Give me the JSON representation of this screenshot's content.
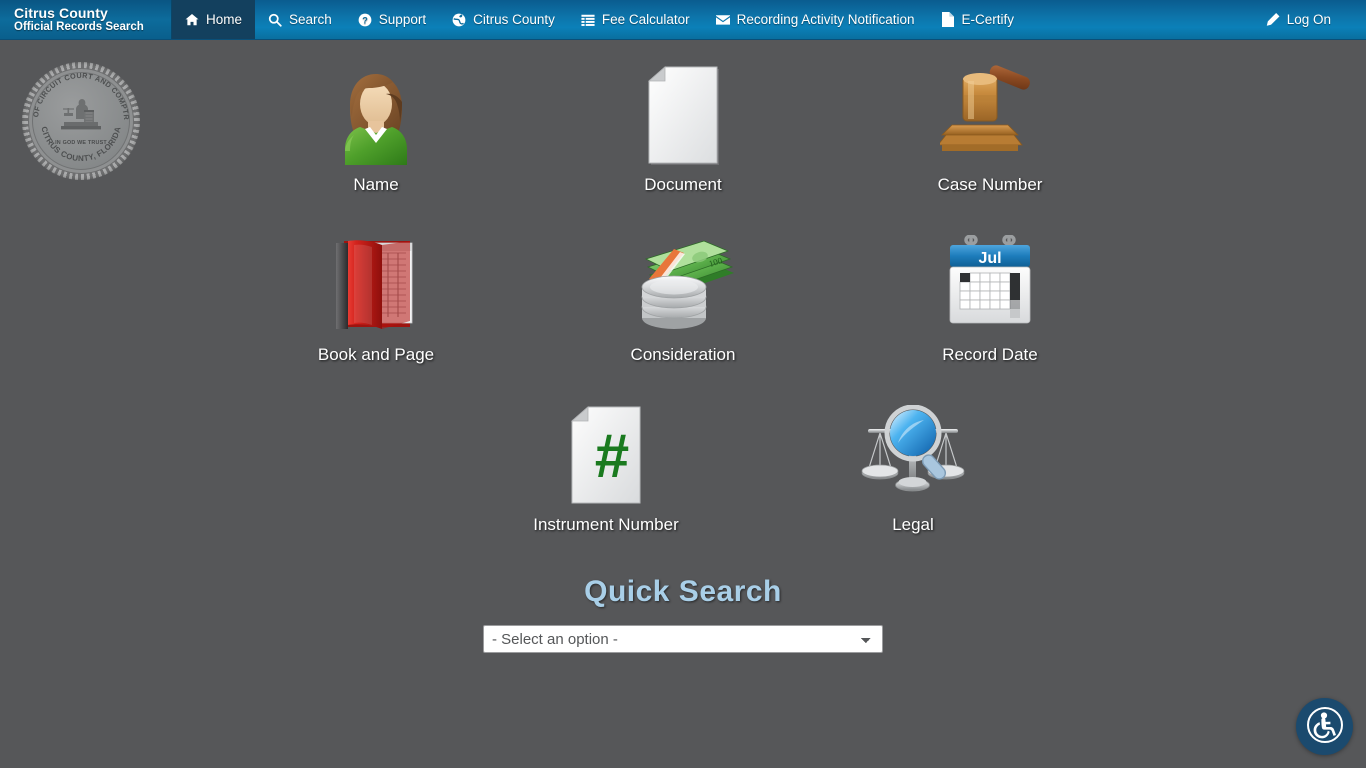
{
  "navbar": {
    "brand": {
      "line1": "Citrus County",
      "line2": "Official Records Search"
    },
    "items": [
      {
        "label": "Home",
        "icon": "home-icon",
        "active": true
      },
      {
        "label": "Search",
        "icon": "search-icon",
        "active": false
      },
      {
        "label": "Support",
        "icon": "question-icon",
        "active": false
      },
      {
        "label": "Citrus County",
        "icon": "globe-icon",
        "active": false
      },
      {
        "label": "Fee Calculator",
        "icon": "list-icon",
        "active": false
      },
      {
        "label": "Recording Activity Notification",
        "icon": "envelope-icon",
        "active": false
      },
      {
        "label": "E-Certify",
        "icon": "file-icon",
        "active": false
      }
    ],
    "right": [
      {
        "label": "Log On",
        "icon": "pencil-icon"
      }
    ]
  },
  "seal": {
    "top_text": "CLERK OF CIRCUIT COURT AND COMPTROLLER",
    "bottom_text": "CITRUS COUNTY, FLORIDA",
    "motto": "IN GOD WE TRUST"
  },
  "tiles": [
    [
      {
        "label": "Name",
        "icon": "person-icon"
      },
      {
        "label": "Document",
        "icon": "document-icon"
      },
      {
        "label": "Case Number",
        "icon": "gavel-icon"
      }
    ],
    [
      {
        "label": "Book and Page",
        "icon": "book-icon"
      },
      {
        "label": "Consideration",
        "icon": "money-icon"
      },
      {
        "label": "Record Date",
        "icon": "calendar-icon"
      }
    ],
    [
      {
        "label": "Instrument Number",
        "icon": "hash-document-icon"
      },
      {
        "label": "Legal",
        "icon": "scales-magnifier-icon"
      }
    ]
  ],
  "calendar": {
    "month": "Jul"
  },
  "quick_search": {
    "title": "Quick Search",
    "selected": "- Select an option -",
    "options": [
      "- Select an option -"
    ]
  },
  "accessibility": {
    "label": "Accessibility Options"
  },
  "colors": {
    "page_background": "#565759",
    "navbar_blue": "#0d75ab",
    "navbar_active": "#13405e",
    "quick_title": "#a9cfe8",
    "accessibility_button": "#1b4a6e"
  }
}
